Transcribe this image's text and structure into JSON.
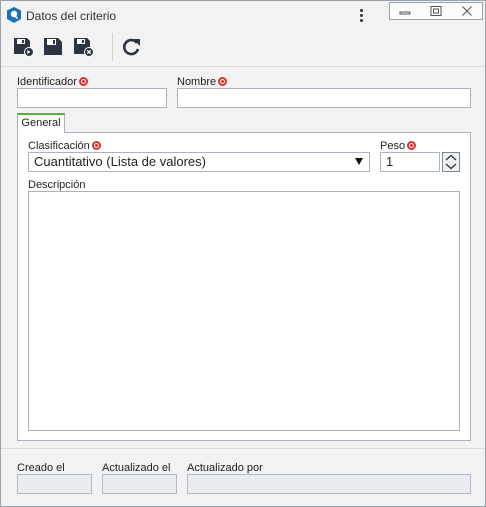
{
  "window": {
    "title": "Datos del criterio"
  },
  "icons": {
    "app": "app-logo-icon",
    "more": "more-vertical-icon",
    "minimize": "minimize-icon",
    "restore": "restore-icon",
    "close": "close-icon",
    "save_new": "save-and-new-icon",
    "save": "save-icon",
    "save_close": "save-and-close-icon",
    "refresh": "refresh-icon"
  },
  "form": {
    "identificador_label": "Identificador",
    "identificador_value": "",
    "nombre_label": "Nombre",
    "nombre_value": ""
  },
  "tabs": [
    {
      "label": "General",
      "active": true
    }
  ],
  "general": {
    "clasificacion_label": "Clasificación",
    "clasificacion_value": "Cuantitativo (Lista de valores)",
    "peso_label": "Peso",
    "peso_value": "1",
    "descripcion_label": "Descripción",
    "descripcion_value": ""
  },
  "footer": {
    "creado_label": "Creado el",
    "creado_value": "",
    "actualizado_el_label": "Actualizado el",
    "actualizado_el_value": "",
    "actualizado_por_label": "Actualizado por",
    "actualizado_por_value": ""
  },
  "colors": {
    "required": "#e03030",
    "tab_accent": "#5cae3f",
    "app_icon": "#1f6fb5"
  }
}
